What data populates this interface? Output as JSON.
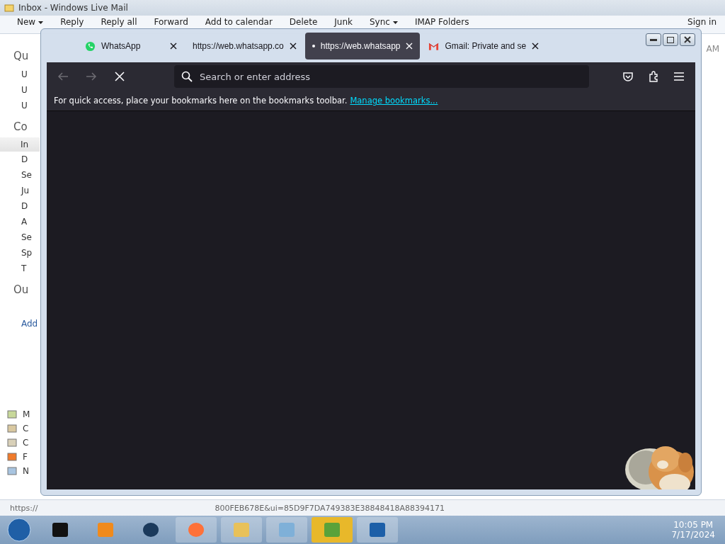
{
  "mail_window": {
    "title": "Inbox - Windows Live Mail",
    "toolbar": [
      {
        "label": "New",
        "kind": "menu"
      },
      {
        "label": "Reply",
        "kind": "plain"
      },
      {
        "label": "Reply all",
        "kind": "plain"
      },
      {
        "label": "Forward",
        "kind": "plain"
      },
      {
        "label": "Add to calendar",
        "kind": "plain"
      },
      {
        "label": "Delete",
        "kind": "plain"
      },
      {
        "label": "Junk",
        "kind": "plain"
      },
      {
        "label": "Sync",
        "kind": "menu"
      },
      {
        "label": "IMAP Folders",
        "kind": "plain"
      }
    ],
    "sign_in": "Sign in",
    "sidebar": [
      {
        "kind": "heading",
        "label": "Qu"
      },
      {
        "kind": "item",
        "label": "U"
      },
      {
        "kind": "item",
        "label": "U"
      },
      {
        "kind": "item",
        "label": "U"
      },
      {
        "kind": "heading",
        "label": "Co"
      },
      {
        "kind": "selected",
        "label": "In"
      },
      {
        "kind": "item",
        "label": "D"
      },
      {
        "kind": "item",
        "label": "Se"
      },
      {
        "kind": "item",
        "label": "Ju"
      },
      {
        "kind": "item",
        "label": "D"
      },
      {
        "kind": "item",
        "label": "A"
      },
      {
        "kind": "item",
        "label": "Se"
      },
      {
        "kind": "item",
        "label": "Sp"
      },
      {
        "kind": "item",
        "label": "T"
      },
      {
        "kind": "heading",
        "label": "Ou"
      },
      {
        "kind": "link",
        "label": "Add"
      }
    ],
    "nav": [
      "M",
      "C",
      "C",
      "F",
      "N"
    ],
    "time_fragment": "AM",
    "status_text": "https://",
    "status_tail": "800FEB678E&ui=85D9F7DA749383E38848418A88394171"
  },
  "browser": {
    "tabs": [
      {
        "title": "WhatsApp",
        "selected": false,
        "loading": false
      },
      {
        "title": "https://web.whatsapp.co",
        "selected": false,
        "loading": false
      },
      {
        "title": "https://web.whatsapp",
        "selected": true,
        "loading": true
      },
      {
        "title": "Gmail: Private and se",
        "selected": false,
        "loading": false
      }
    ],
    "address_placeholder": "Search or enter address",
    "bookmarks_hint": "For quick access, place your bookmarks here on the bookmarks toolbar.",
    "bookmarks_link": "Manage bookmarks..."
  },
  "taskbar": {
    "time": "10:05 PM",
    "date": "7/17/2024"
  }
}
